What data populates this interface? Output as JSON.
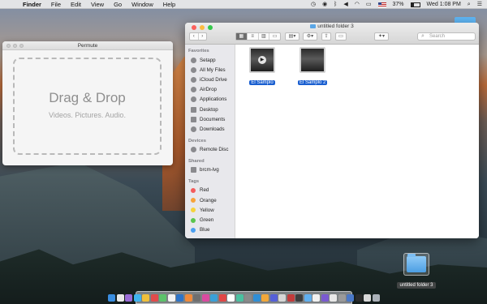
{
  "menubar": {
    "app": "Finder",
    "items": [
      "File",
      "Edit",
      "View",
      "Go",
      "Window",
      "Help"
    ],
    "battery": "37%",
    "clock": "Wed 1:08 PM"
  },
  "permute": {
    "title": "Permute",
    "drop_title": "Drag & Drop",
    "drop_subtitle": "Videos. Pictures. Audio."
  },
  "finder": {
    "title": "untitled folder 3",
    "search_placeholder": "Search",
    "sidebar": {
      "favorites_heading": "Favorites",
      "favorites": [
        "Setapp",
        "All My Files",
        "iCloud Drive",
        "AirDrop",
        "Applications",
        "Desktop",
        "Documents",
        "Downloads"
      ],
      "devices_heading": "Devices",
      "devices": [
        "Remote Disc"
      ],
      "shared_heading": "Shared",
      "shared": [
        "brcm-lvg"
      ],
      "tags_heading": "Tags",
      "tags": [
        {
          "label": "Red",
          "color": "#f45b5b"
        },
        {
          "label": "Orange",
          "color": "#f7a33a"
        },
        {
          "label": "Yellow",
          "color": "#f6d23c"
        },
        {
          "label": "Green",
          "color": "#5ac54d"
        },
        {
          "label": "Blue",
          "color": "#4a9ff0"
        }
      ]
    },
    "files": [
      "El Samplo",
      "El Samplo 2"
    ]
  },
  "desktop": {
    "folder_label": "untitled folder 3"
  },
  "dock": {
    "icon_colors": [
      "#3a8de0",
      "#e8e8e8",
      "#9a6cd6",
      "#3fb3f0",
      "#f0c03a",
      "#e24b4b",
      "#5cc26a",
      "#f2f2f2",
      "#2d74c8",
      "#f08a3a",
      "#6f6f6f",
      "#d94aa0",
      "#3aa0d8",
      "#e04646",
      "#fff",
      "#4ac0a0",
      "#8a8a8a",
      "#2f8fd6",
      "#f2a83a",
      "#5560d8",
      "#d6d6d6",
      "#c23b3b",
      "#3d3d3d",
      "#60b0f0",
      "#f0f0f0",
      "#7a5ad0",
      "#e8e8e8",
      "#9a9a9a",
      "#4a78c8",
      "#2a2a2a",
      "#d8d8d8",
      "#aab0b8"
    ]
  }
}
